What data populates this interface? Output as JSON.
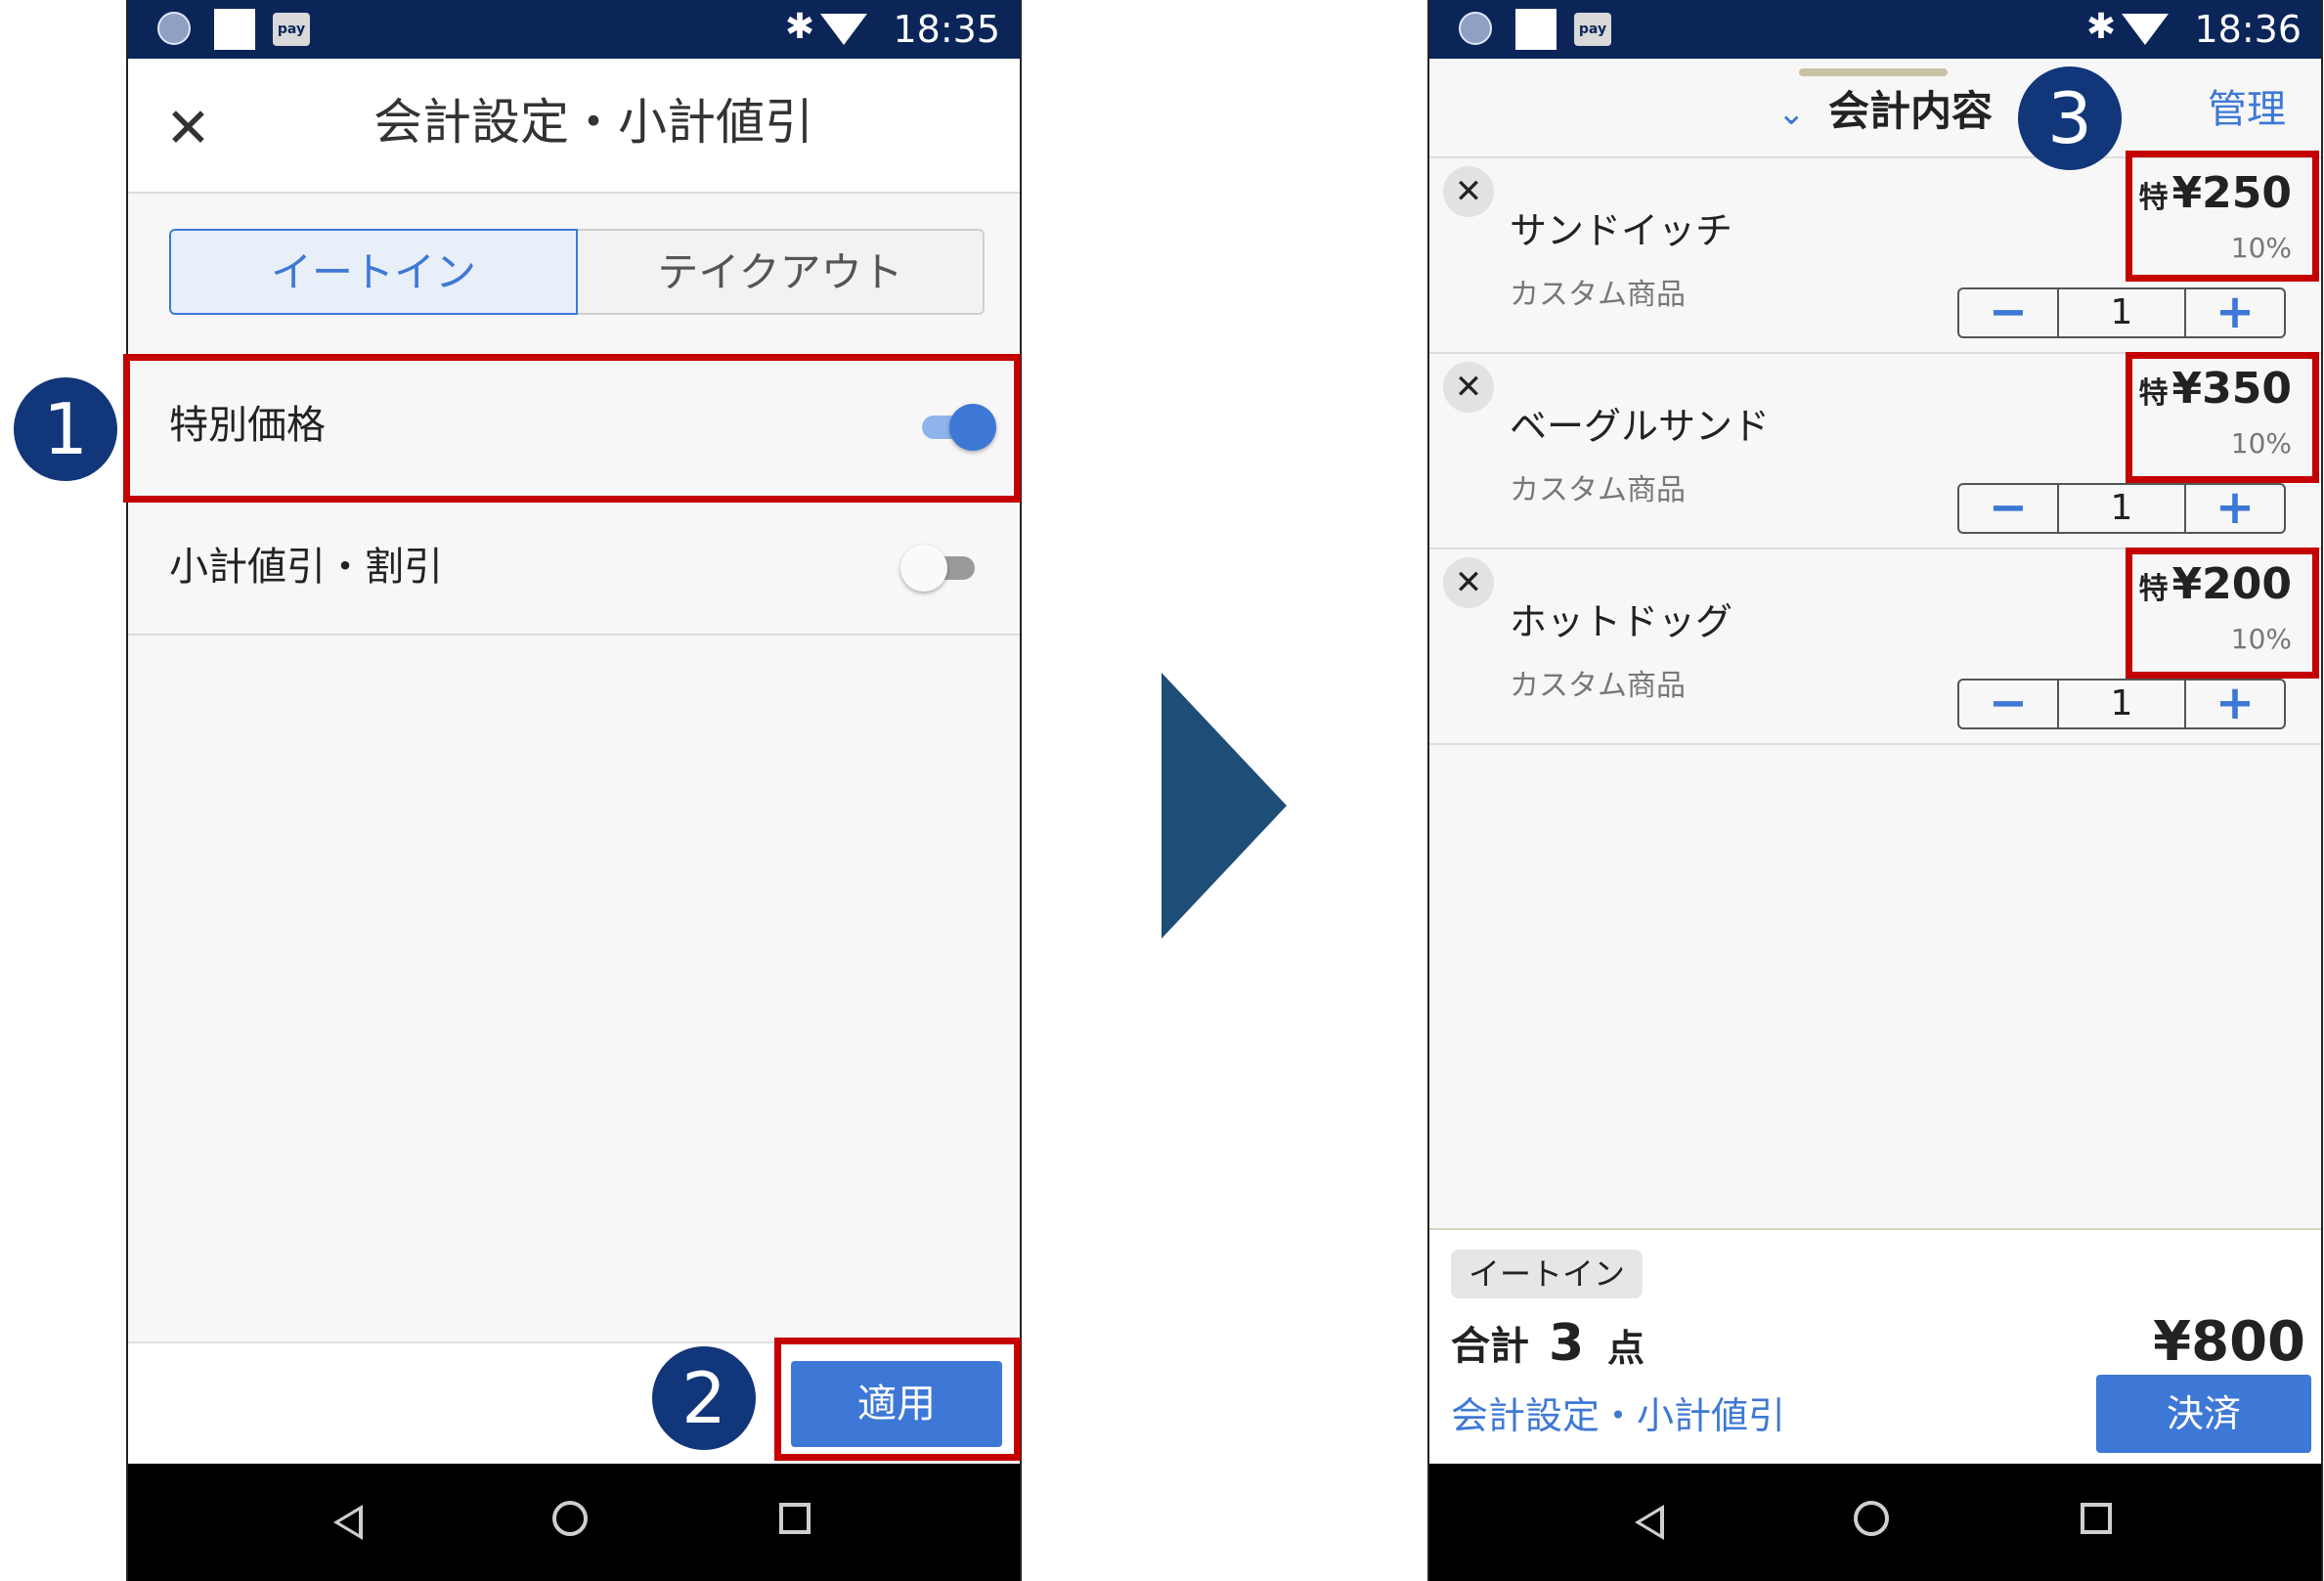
{
  "left_screen": {
    "status": {
      "pay_icon_label": "pay",
      "time": "18:35"
    },
    "appbar": {
      "title": "会計設定・小計値引"
    },
    "segment": {
      "option1": "イートイン",
      "option2": "テイクアウト",
      "selected": "イートイン"
    },
    "settings": [
      {
        "label": "特別価格",
        "enabled": true
      },
      {
        "label": "小計値引・割引",
        "enabled": false
      }
    ],
    "apply_label": "適用"
  },
  "right_screen": {
    "status": {
      "pay_icon_label": "pay",
      "time": "18:36"
    },
    "header": {
      "title": "会計内容",
      "manage_label": "管理"
    },
    "items": [
      {
        "name": "サンドイッチ",
        "sub": "カスタム商品",
        "special_mark": "特",
        "price": "¥250",
        "tax": "10%",
        "qty": "1"
      },
      {
        "name": "ベーグルサンド",
        "sub": "カスタム商品",
        "special_mark": "特",
        "price": "¥350",
        "tax": "10%",
        "qty": "1"
      },
      {
        "name": "ホットドッグ",
        "sub": "カスタム商品",
        "special_mark": "特",
        "price": "¥200",
        "tax": "10%",
        "qty": "1"
      }
    ],
    "footer": {
      "mode_badge": "イートイン",
      "total_label": "合計",
      "total_count": "3",
      "total_unit": "点",
      "total_amount": "¥800",
      "settings_link": "会計設定・小計値引",
      "pay_label": "決済"
    }
  },
  "callouts": [
    "1",
    "2",
    "3"
  ],
  "colors": {
    "accent": "#3e78d6",
    "status_bar": "#0b2559",
    "highlight": "#c40000",
    "callout": "#11367a",
    "arrow": "#1e4d78"
  }
}
